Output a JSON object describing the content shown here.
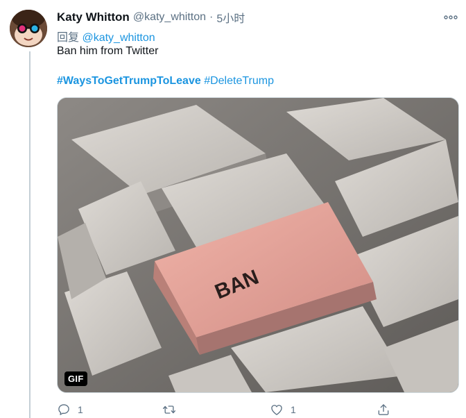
{
  "tweet": {
    "author_name": "Katy Whitton",
    "author_handle": "@katy_whitton",
    "separator": "·",
    "time": "5小时",
    "reply_prefix": "回复",
    "reply_mention": "@katy_whitton",
    "text": "Ban him from Twitter",
    "hashtags": [
      "#WaysToGetTrumpToLeave",
      "#DeleteTrump"
    ],
    "media": {
      "badge": "GIF",
      "key_label": "BAN"
    },
    "actions": {
      "reply_count": "1",
      "retweet_count": "",
      "like_count": "1"
    }
  },
  "colors": {
    "link": "#1b95e0",
    "secondary_text": "#5b7083",
    "primary_text": "#0f1419"
  },
  "icons": [
    "avatar",
    "more-icon",
    "reply-icon",
    "retweet-icon",
    "like-icon",
    "share-icon"
  ]
}
